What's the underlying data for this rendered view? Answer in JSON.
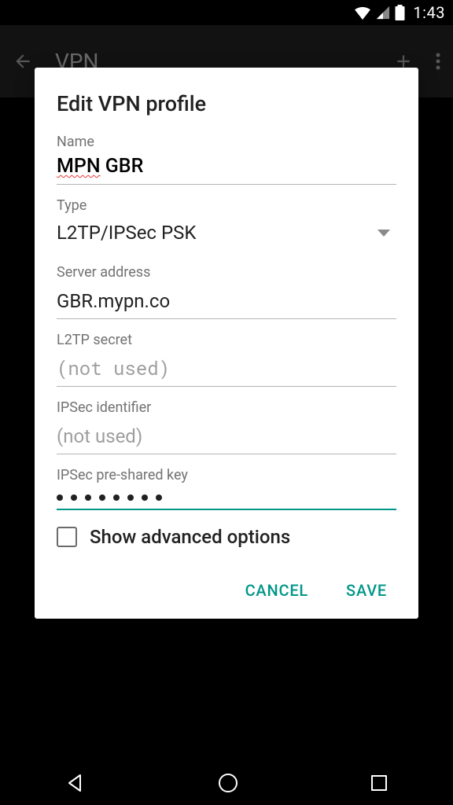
{
  "statusbar": {
    "time": "1:43"
  },
  "appbar": {
    "title": "VPN"
  },
  "dialog": {
    "title": "Edit VPN profile",
    "name": {
      "label": "Name",
      "value_part1": "MPN",
      "value_part2": "GBR"
    },
    "type": {
      "label": "Type",
      "value": "L2TP/IPSec PSK"
    },
    "server": {
      "label": "Server address",
      "value": "GBR.mypn.co"
    },
    "l2tp_secret": {
      "label": "L2TP secret",
      "placeholder": "(not used)",
      "value": ""
    },
    "ipsec_id": {
      "label": "IPSec identifier",
      "placeholder": "(not used)",
      "value": ""
    },
    "psk": {
      "label": "IPSec pre-shared key",
      "length": 8
    },
    "advanced": {
      "label": "Show advanced options",
      "checked": false
    },
    "actions": {
      "cancel": "CANCEL",
      "save": "SAVE"
    }
  },
  "colors": {
    "accent": "#009688"
  }
}
